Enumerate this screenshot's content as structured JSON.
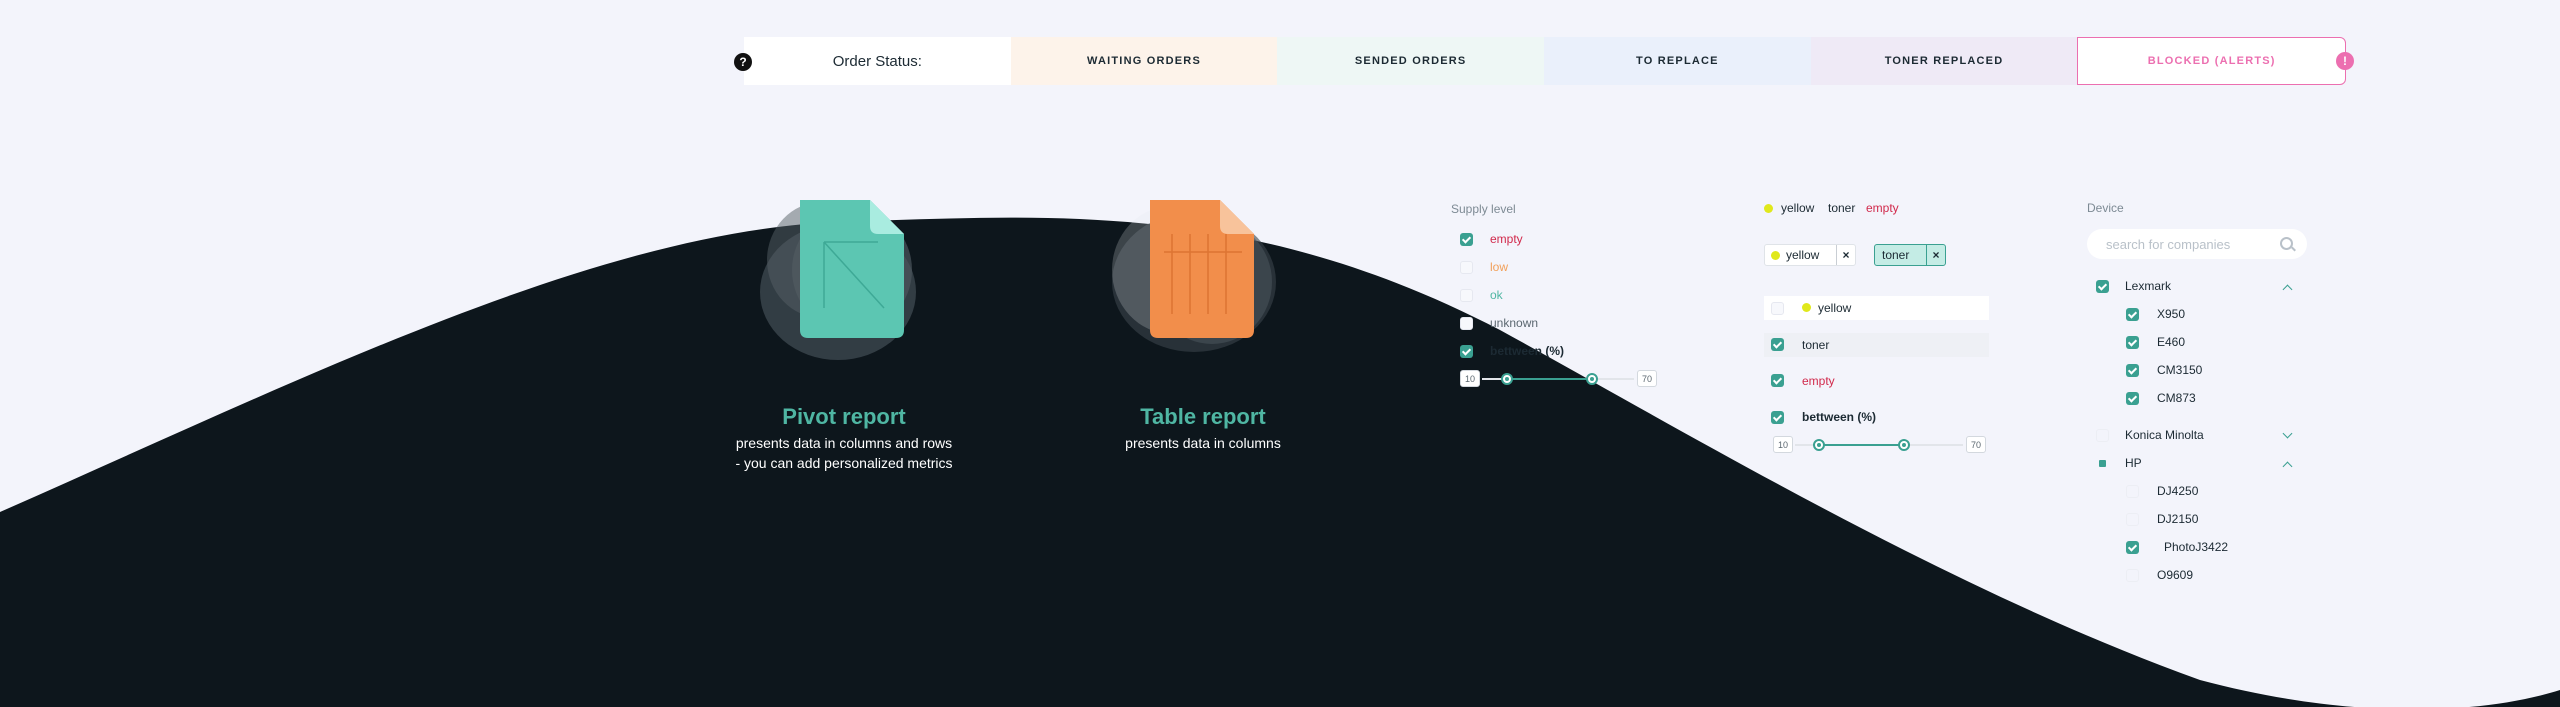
{
  "status_bar": {
    "title": "Order Status:",
    "help_icon": "?",
    "alert_icon": "!",
    "items": [
      {
        "label": "WAITING ORDERS"
      },
      {
        "label": "SENDED ORDERS"
      },
      {
        "label": "TO REPLACE"
      },
      {
        "label": "TONER REPLACED"
      },
      {
        "label": "BLOCKED (ALERTS)"
      }
    ],
    "colors": {
      "blocked": "#ec6fb0"
    }
  },
  "reports": [
    {
      "title": "Pivot report",
      "desc_lines": [
        "presents data in columns and rows",
        "- you can add personalized metrics"
      ],
      "icon": "pivot-document-icon",
      "color": "#5cc6b2"
    },
    {
      "title": "Table report",
      "desc_lines": [
        "presents data in columns"
      ],
      "icon": "table-document-icon",
      "color": "#f28e4b"
    }
  ],
  "supply_level": {
    "label": "Supply level",
    "options": [
      {
        "label": "empty",
        "checked": true
      },
      {
        "label": "low",
        "checked": false
      },
      {
        "label": "ok",
        "checked": false
      },
      {
        "label": "unknown",
        "checked": false
      },
      {
        "label": "bettween (%)",
        "checked": true
      }
    ],
    "range": {
      "min": "10",
      "max": "70"
    }
  },
  "filters": {
    "summary": {
      "color": "yellow",
      "type": "toner",
      "level": "empty"
    },
    "chips": [
      {
        "label": "yellow",
        "remove": "×"
      },
      {
        "label": "toner",
        "remove": "×"
      }
    ],
    "rows": [
      {
        "label": "yellow",
        "checked": false
      },
      {
        "label": "toner",
        "checked": true
      },
      {
        "label": "empty",
        "checked": true
      },
      {
        "label": "bettween (%)",
        "checked": true
      }
    ],
    "range": {
      "min": "10",
      "max": "70"
    }
  },
  "device": {
    "label": "Device",
    "search_placeholder": "search for companies",
    "groups": [
      {
        "name": "Lexmark",
        "state": "checked",
        "expanded": true,
        "items": [
          {
            "label": "X950",
            "checked": true
          },
          {
            "label": "E460",
            "checked": true
          },
          {
            "label": "CM3150",
            "checked": true
          },
          {
            "label": "CM873",
            "checked": true
          }
        ]
      },
      {
        "name": "Konica Minolta",
        "state": "unchecked",
        "expanded": false,
        "items": []
      },
      {
        "name": "HP",
        "state": "partial",
        "expanded": true,
        "items": [
          {
            "label": "DJ4250",
            "checked": false
          },
          {
            "label": "DJ2150",
            "checked": false
          },
          {
            "label": "PhotoJ3422",
            "checked": true
          },
          {
            "label": "O9609",
            "checked": false
          }
        ]
      }
    ]
  },
  "colors": {
    "accent": "#3aa091",
    "dark": "#0d161c",
    "background": "#f3f4fb"
  }
}
